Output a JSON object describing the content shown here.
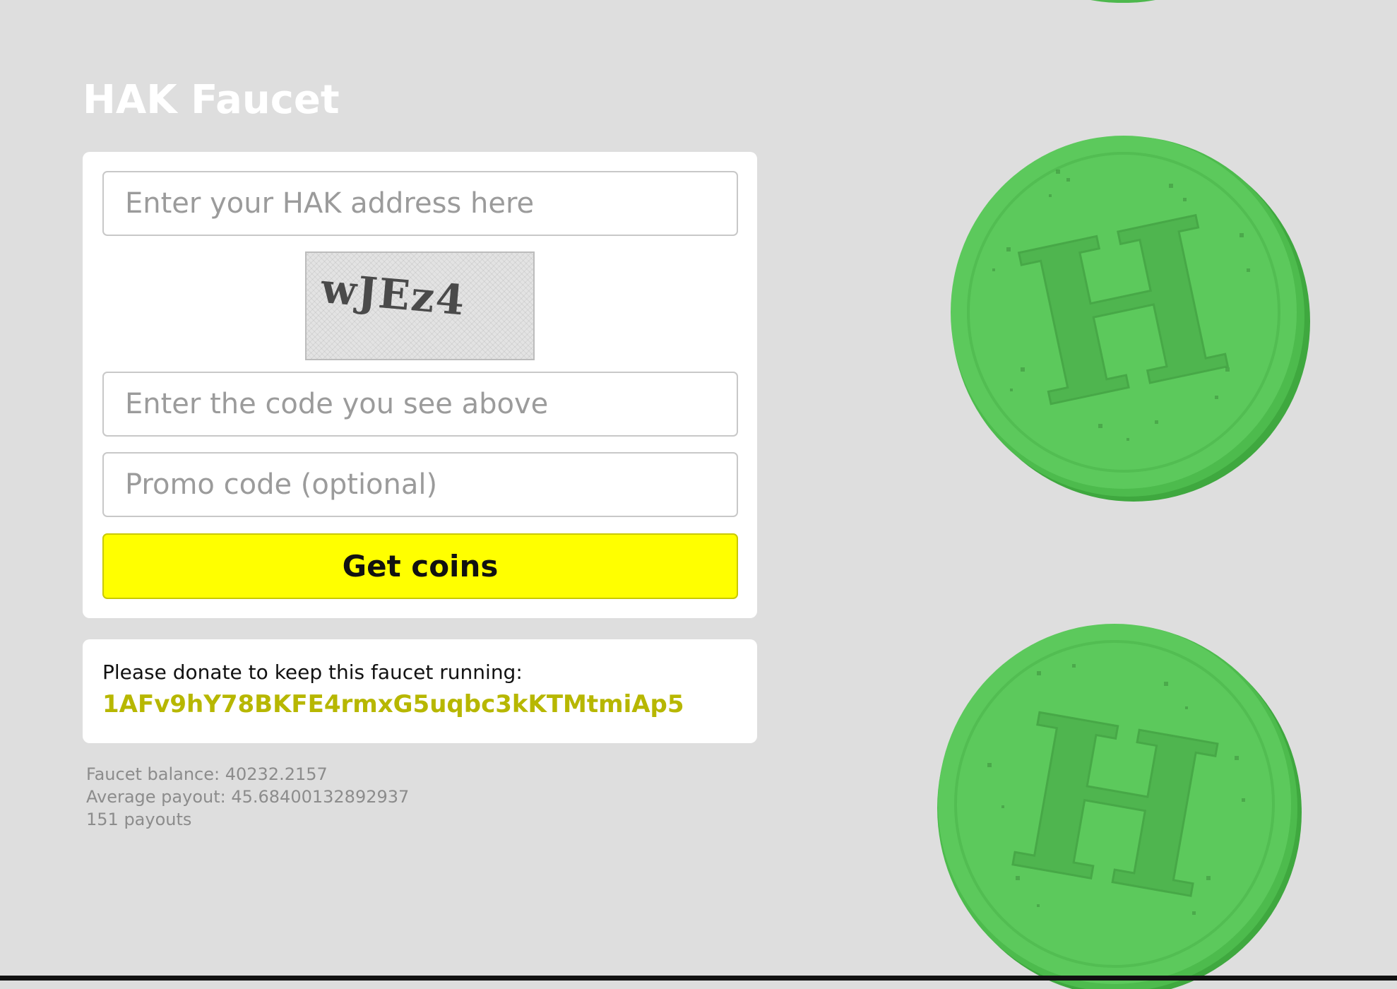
{
  "header": {
    "title": "HAK Faucet"
  },
  "form": {
    "address_placeholder": "Enter your HAK address here",
    "captcha_text": "wJEz4",
    "captcha_placeholder": "Enter the code you see above",
    "promo_placeholder": "Promo code (optional)",
    "submit_label": "Get coins"
  },
  "donate": {
    "label": "Please donate to keep this faucet running:",
    "address": "1AFv9hY78BKFE4rmxG5uqbc3kKTMtmiAp5"
  },
  "stats": {
    "balance": "Faucet balance: 40232.2157",
    "average": "Average payout: 45.68400132892937",
    "payouts": "151 payouts"
  },
  "decor": {
    "coin_letter": "H",
    "coin_color": "#5cc95c",
    "accent_color": "#ffff00",
    "address_color": "#b7b700"
  }
}
